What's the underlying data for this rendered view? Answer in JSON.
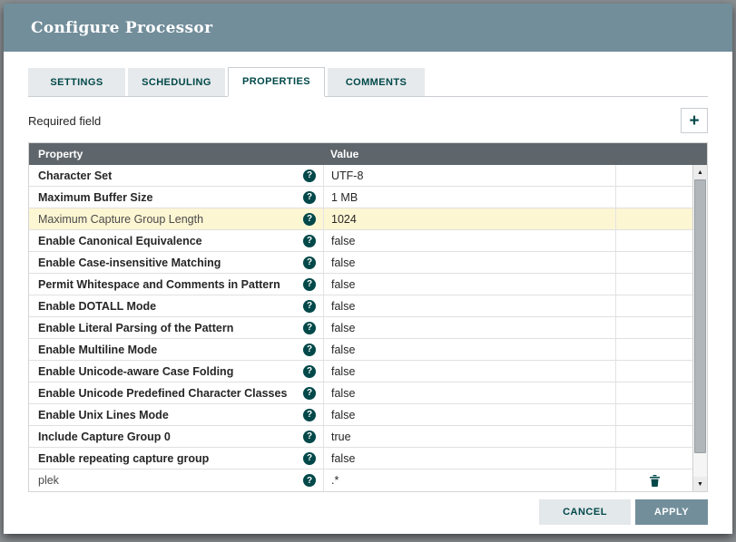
{
  "dialog": {
    "title": "Configure Processor",
    "tabs": [
      {
        "label": "SETTINGS",
        "active": false
      },
      {
        "label": "SCHEDULING",
        "active": false
      },
      {
        "label": "PROPERTIES",
        "active": true
      },
      {
        "label": "COMMENTS",
        "active": false
      }
    ],
    "required_field_label": "Required field"
  },
  "icons": {
    "plus": "+",
    "help": "?",
    "scroll_up": "▲",
    "scroll_down": "▼"
  },
  "table": {
    "columns": [
      "Property",
      "Value"
    ],
    "rows": [
      {
        "property": "Character Set",
        "value": "UTF-8",
        "bold": true,
        "highlight": false,
        "deletable": false
      },
      {
        "property": "Maximum Buffer Size",
        "value": "1 MB",
        "bold": true,
        "highlight": false,
        "deletable": false
      },
      {
        "property": "Maximum Capture Group Length",
        "value": "1024",
        "bold": false,
        "highlight": true,
        "deletable": false
      },
      {
        "property": "Enable Canonical Equivalence",
        "value": "false",
        "bold": true,
        "highlight": false,
        "deletable": false
      },
      {
        "property": "Enable Case-insensitive Matching",
        "value": "false",
        "bold": true,
        "highlight": false,
        "deletable": false
      },
      {
        "property": "Permit Whitespace and Comments in Pattern",
        "value": "false",
        "bold": true,
        "highlight": false,
        "deletable": false
      },
      {
        "property": "Enable DOTALL Mode",
        "value": "false",
        "bold": true,
        "highlight": false,
        "deletable": false
      },
      {
        "property": "Enable Literal Parsing of the Pattern",
        "value": "false",
        "bold": true,
        "highlight": false,
        "deletable": false
      },
      {
        "property": "Enable Multiline Mode",
        "value": "false",
        "bold": true,
        "highlight": false,
        "deletable": false
      },
      {
        "property": "Enable Unicode-aware Case Folding",
        "value": "false",
        "bold": true,
        "highlight": false,
        "deletable": false
      },
      {
        "property": "Enable Unicode Predefined Character Classes",
        "value": "false",
        "bold": true,
        "highlight": false,
        "deletable": false
      },
      {
        "property": "Enable Unix Lines Mode",
        "value": "false",
        "bold": true,
        "highlight": false,
        "deletable": false
      },
      {
        "property": "Include Capture Group 0",
        "value": "true",
        "bold": true,
        "highlight": false,
        "deletable": false
      },
      {
        "property": "Enable repeating capture group",
        "value": "false",
        "bold": true,
        "highlight": false,
        "deletable": false
      },
      {
        "property": "plek",
        "value": ".*",
        "bold": false,
        "highlight": false,
        "deletable": true
      }
    ]
  },
  "footer": {
    "cancel_label": "CANCEL",
    "apply_label": "APPLY"
  },
  "colors": {
    "titlebar": "#728e9b",
    "table_header": "#5e666c",
    "accent": "#004849",
    "highlight_row": "#fdf6d3",
    "apply_button": "#728e9b",
    "cancel_button": "#e3e8eb"
  }
}
